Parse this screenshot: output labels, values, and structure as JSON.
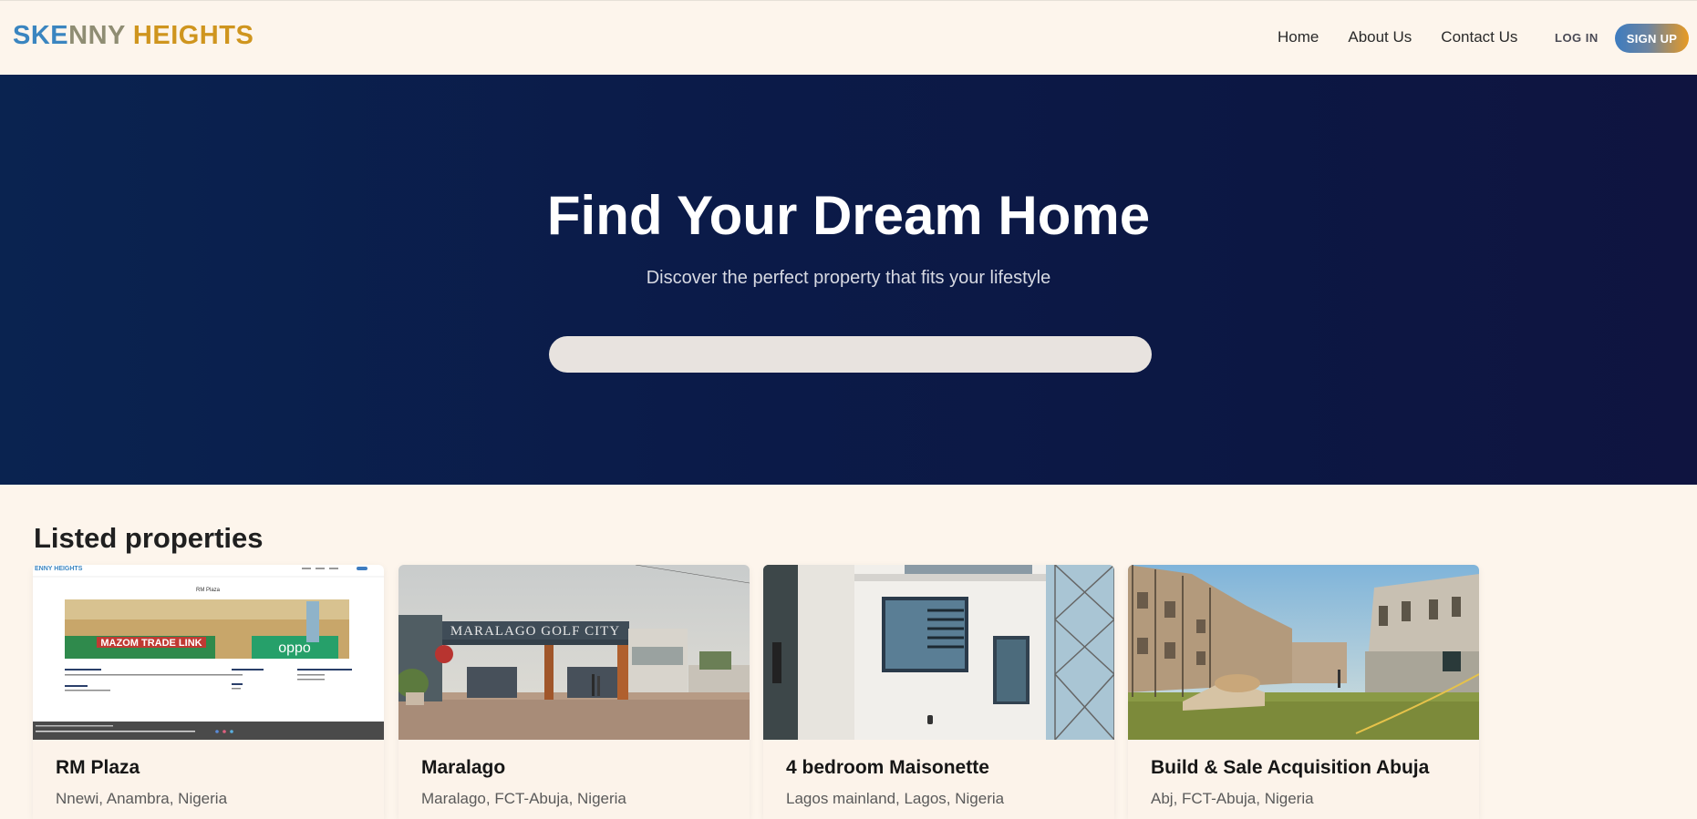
{
  "navbar": {
    "logo_part1": "SKE",
    "logo_part2": "NNY ",
    "logo_part3": "HEIGHTS",
    "links": [
      "Home",
      "About Us",
      "Contact Us"
    ],
    "login_label": "LOG IN",
    "signup_label": "SIGN UP"
  },
  "hero": {
    "title": "Find Your Dream Home",
    "subtitle": "Discover the perfect property that fits your lifestyle",
    "search_value": ""
  },
  "listings": {
    "title": "Listed properties",
    "items": [
      {
        "name": "RM Plaza",
        "location": "Nnewi, Anambra, Nigeria",
        "image": "website-screenshot-thumbnail"
      },
      {
        "name": "Maralago",
        "location": "Maralago, FCT-Abuja, Nigeria",
        "image": "estate-gate-photo"
      },
      {
        "name": "4 bedroom Maisonette",
        "location": "Lagos mainland, Lagos, Nigeria",
        "image": "white-house-facade-photo"
      },
      {
        "name": "Build & Sale Acquisition Abuja",
        "location": "Abj, FCT-Abuja, Nigeria",
        "image": "construction-site-photo"
      }
    ],
    "thumb1_brand": "ENNY HEIGHTS",
    "thumb1_heading": "RM Plaza",
    "thumb1_sign1": "MAZOM TRADE LINK",
    "thumb1_sign2": "oppo",
    "thumb2_sign": "MARALAGO GOLF CITY"
  },
  "colors": {
    "logo_blue": "#3a85c0",
    "logo_gold": "#cf951e",
    "hero_bg": "#0b1b49",
    "page_bg": "#fdf5ec"
  }
}
